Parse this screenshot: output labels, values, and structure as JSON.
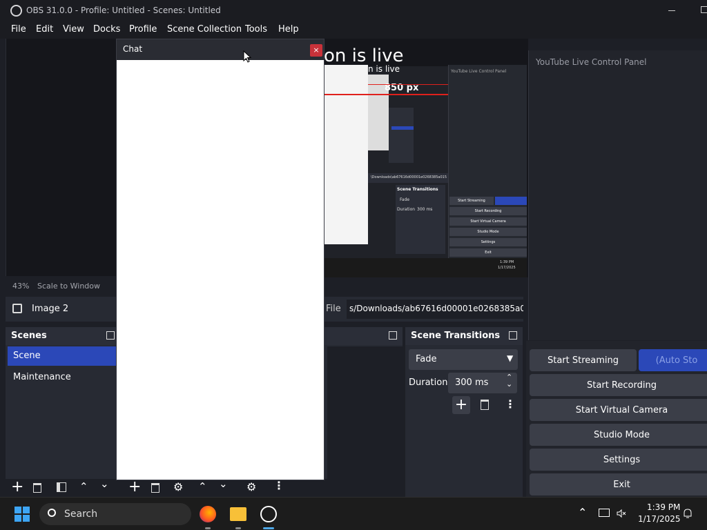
{
  "window": {
    "title": "OBS 31.0.0 - Profile: Untitled - Scenes: Untitled"
  },
  "menu": [
    "File",
    "Edit",
    "View",
    "Docks",
    "Profile",
    "Scene Collection",
    "Tools",
    "Help"
  ],
  "chat": {
    "title": "Chat",
    "close": "×"
  },
  "preview": {
    "banner": "on is live",
    "banner_small": "n is live",
    "measure": "850 px",
    "inner_panel_title": "YouTube Live Control Panel",
    "inner_path": "\\Downloads\\ab67616d00001e0268385a015",
    "inner_transitions": "Scene Transitions",
    "inner_fade": "Fade",
    "inner_duration": "Duration",
    "inner_duration_val": "300 ms",
    "inner_controls": [
      "Start Streaming",
      "Start Recording",
      "Start Virtual Camera",
      "Studio Mode",
      "Settings",
      "Exit"
    ],
    "inner_clock": "1:39 PM",
    "inner_date": "1/17/2025"
  },
  "youtube_panel": {
    "title": "YouTube Live Control Panel"
  },
  "zoom": {
    "percent": "43%",
    "mode": "Scale to Window"
  },
  "source_bar": {
    "name": "Image 2",
    "file_label": "File",
    "file_path": "s/Downloads/ab67616d00001e0268385a015"
  },
  "scenes": {
    "title": "Scenes",
    "items": [
      "Scene",
      "Maintenance"
    ],
    "selected": "Scene"
  },
  "transitions": {
    "title": "Scene Transitions",
    "type": "Fade",
    "duration_label": "Duration",
    "duration_value": "300 ms"
  },
  "controls": {
    "start_streaming": "Start Streaming",
    "auto": "(Auto Sto",
    "start_recording": "Start Recording",
    "virtual_camera": "Start Virtual Camera",
    "studio_mode": "Studio Mode",
    "settings": "Settings",
    "exit": "Exit"
  },
  "taskbar": {
    "search": "Search",
    "time": "1:39 PM",
    "date": "1/17/2025"
  },
  "colors": {
    "accent": "#2b48b8",
    "title_bar": "#1b1c21",
    "dock_bg": "#272a33",
    "live_line": "#e0201c"
  }
}
